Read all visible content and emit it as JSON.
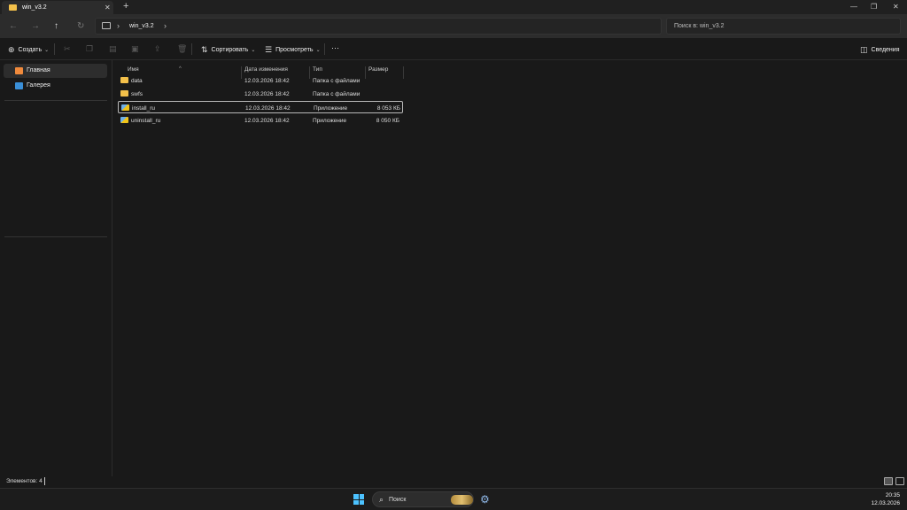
{
  "window": {
    "tab_title": "win_v3.2",
    "tab_close": "✕",
    "new_tab": "+",
    "minimize": "—",
    "maximize": "❐",
    "close": "✕"
  },
  "address": {
    "chevron": "›",
    "crumb": "win_v3.2",
    "search_placeholder": "Поиск в: win_v3.2"
  },
  "toolbar": {
    "create_label": "Создать",
    "sort_label": "Сортировать",
    "view_label": "Просмотреть",
    "more_label": "···",
    "details_label": "Сведения"
  },
  "sidebar": {
    "items": [
      {
        "label": "Главная",
        "icon": "home-icon"
      },
      {
        "label": "Галерея",
        "icon": "gallery-icon"
      }
    ]
  },
  "columns": {
    "name": "Имя",
    "date": "Дата изменения",
    "type": "Тип",
    "size": "Размер"
  },
  "files": [
    {
      "name": "data",
      "date": "12.03.2026 18:42",
      "type": "Папка с файлами",
      "size": "",
      "kind": "folder"
    },
    {
      "name": "swfs",
      "date": "12.03.2026 18:42",
      "type": "Папка с файлами",
      "size": "",
      "kind": "folder"
    },
    {
      "name": "install_ru",
      "date": "12.03.2026 18:42",
      "type": "Приложение",
      "size": "8 053 КБ",
      "kind": "app"
    },
    {
      "name": "uninstall_ru",
      "date": "12.03.2026 18:42",
      "type": "Приложение",
      "size": "8 050 КБ",
      "kind": "app"
    }
  ],
  "status": {
    "items_text": "Элементов: 4"
  },
  "taskbar": {
    "search_label": "Поиск",
    "time": "20:35",
    "date": "12.03.2026"
  },
  "colors": {
    "accent": "#4cc2ff",
    "folder": "#f3c04a"
  }
}
